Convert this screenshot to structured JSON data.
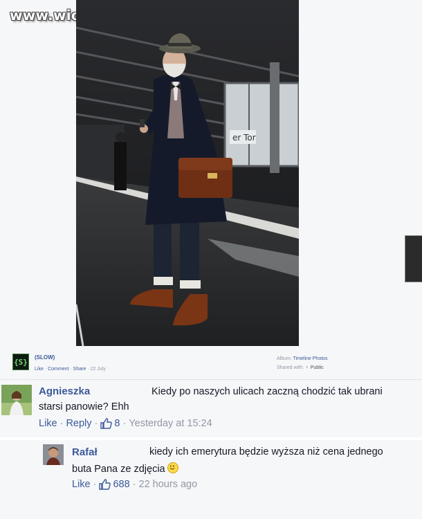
{
  "watermark": {
    "text": "www.wiocha.pl"
  },
  "post": {
    "page_name": "(SLOW)",
    "logo_text": "{S}",
    "actions": {
      "like": "Like",
      "comment": "Comment",
      "share": "Share",
      "date": "22 July"
    },
    "album": {
      "label": "Album:",
      "value": "Timeline Photos",
      "shared_label": "Shared with:",
      "shared_value": "Public"
    },
    "photo": {
      "sign_text": "er Tor"
    }
  },
  "comments": [
    {
      "author": "Agnieszka",
      "line1": "Kiedy po naszych ulicach zaczną chodzić tak ubrani",
      "line2": "starsi panowie? Ehh",
      "like_label": "Like",
      "reply_label": "Reply",
      "like_count": "8",
      "time": "Yesterday at 15:24"
    },
    {
      "author": "Rafał",
      "line1": "kiedy ich emerytura będzie wyższa niż cena jednego",
      "line2": "buta Pana ze zdjęcia",
      "like_label": "Like",
      "like_count": "688",
      "time": "22 hours ago"
    }
  ],
  "colors": {
    "link": "#3b5998",
    "meta": "#9197a3",
    "background": "#f6f7f9"
  }
}
